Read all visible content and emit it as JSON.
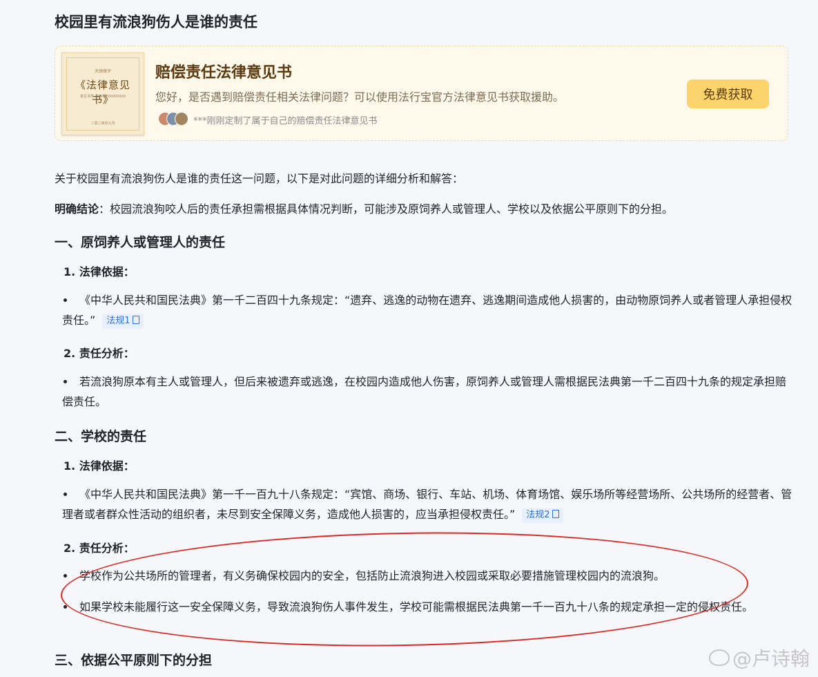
{
  "page_title": "校园里有流浪狗伤人是谁的责任",
  "promo": {
    "book_top": "天驰律评",
    "book_title": "《法律意见书》",
    "book_sub": "意见书号 2024KF00000000",
    "book_foot": "二零二四年九月",
    "title": "赔偿责任法律意见书",
    "description": "您好，是否遇到赔偿责任相关法律问题？可以使用法行宝官方法律意见书获取援助。",
    "note": "***刚刚定制了属于自己的赔偿责任法律意见书",
    "button_label": "免费获取"
  },
  "intro": "关于校园里有流浪狗伤人是谁的责任这一问题，以下是对此问题的详细分析和解答：",
  "conclusion": {
    "label": "明确结论",
    "text": "：校园流浪狗咬人后的责任承担需根据具体情况判断，可能涉及原饲养人或管理人、学校以及依据公平原则下的分担。"
  },
  "sections": [
    {
      "heading": "一、原饲养人或管理人的责任",
      "legal_basis_label": "1. 法律依据：",
      "legal_text": "《中华人民共和国民法典》第一千二百四十九条规定：“遗弃、逃逸的动物在遗弃、逃逸期间造成他人损害的，由动物原饲养人或者管理人承担侵权责任。”",
      "law_tag": "法规1",
      "analysis_label": "2. 责任分析：",
      "analysis": [
        "若流浪狗原本有主人或管理人，但后来被遗弃或逃逸，在校园内造成他人伤害，原饲养人或管理人需根据民法典第一千二百四十九条的规定承担赔偿责任。"
      ]
    },
    {
      "heading": "二、学校的责任",
      "legal_basis_label": "1. 法律依据：",
      "legal_text": "《中华人民共和国民法典》第一千一百九十八条规定：“宾馆、商场、银行、车站、机场、体育场馆、娱乐场所等经营场所、公共场所的经营者、管理者或者群众性活动的组织者，未尽到安全保障义务，造成他人损害的，应当承担侵权责任。”",
      "law_tag": "法规2",
      "analysis_label": "2. 责任分析：",
      "analysis": [
        "学校作为公共场所的管理者，有义务确保校园内的安全，包括防止流浪狗进入校园或采取必要措施管理校园内的流浪狗。",
        "如果学校未能履行这一安全保障义务，导致流浪狗伤人事件发生，学校可能需根据民法典第一千一百九十八条的规定承担一定的侵权责任。"
      ]
    },
    {
      "heading": "三、依据公平原则下的分担"
    }
  ],
  "watermark": "@卢诗翰",
  "colors": {
    "annotation_ellipse": "#e0261f",
    "promo_button": "#fbd46b",
    "law_tag_text": "#2f6fe0"
  }
}
